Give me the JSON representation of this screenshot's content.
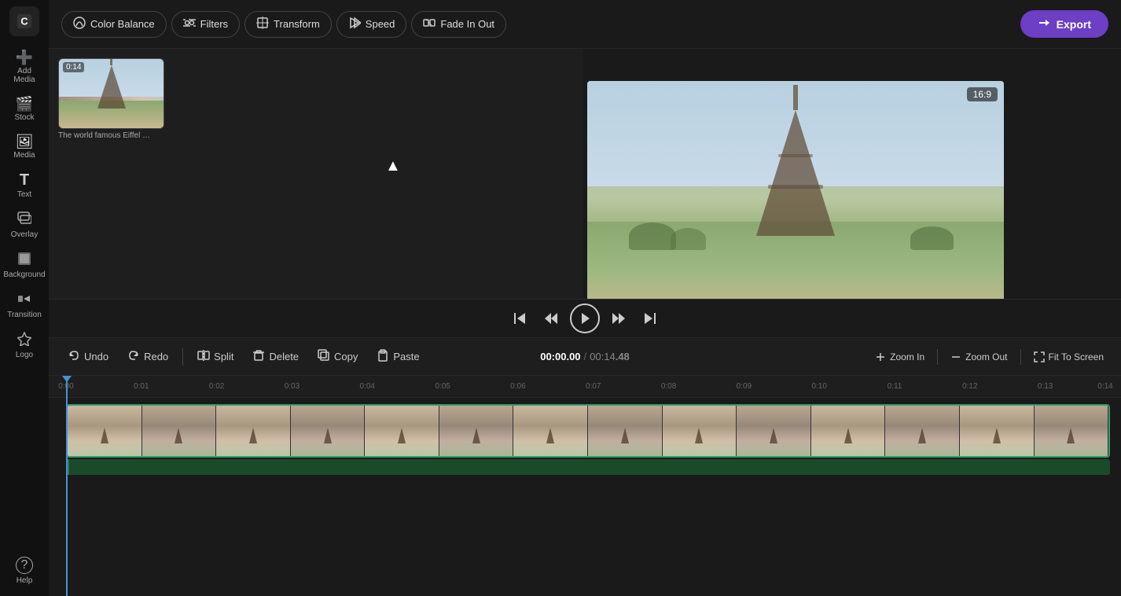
{
  "app": {
    "logo_letter": "C",
    "aspect_ratio": "16:9"
  },
  "sidebar": {
    "items": [
      {
        "id": "add-media",
        "icon": "➕",
        "label": "Add Media"
      },
      {
        "id": "stock",
        "icon": "🎬",
        "label": "Stock"
      },
      {
        "id": "media",
        "icon": "🖼️",
        "label": "Media"
      },
      {
        "id": "text",
        "icon": "T",
        "label": "Text"
      },
      {
        "id": "overlay",
        "icon": "⬛",
        "label": "Overlay"
      },
      {
        "id": "background",
        "icon": "🟪",
        "label": "Background"
      },
      {
        "id": "transition",
        "icon": "↔",
        "label": "Transition"
      },
      {
        "id": "logo",
        "icon": "⭐",
        "label": "Logo"
      },
      {
        "id": "help",
        "icon": "?",
        "label": "Help"
      }
    ]
  },
  "toolbar": {
    "color_balance": "Color Balance",
    "filters": "Filters",
    "transform": "Transform",
    "speed": "Speed",
    "fade_in_out": "Fade In Out",
    "export": "Export"
  },
  "media": {
    "thumb": {
      "time": "0:14",
      "label": "The world famous Eiffel …"
    }
  },
  "playback": {
    "skip_start": "⏮",
    "rewind": "⏪",
    "play": "▶",
    "fast_forward": "⏩",
    "skip_end": "⏭"
  },
  "action_toolbar": {
    "undo": "Undo",
    "redo": "Redo",
    "split": "Split",
    "delete": "Delete",
    "copy": "Copy",
    "paste": "Paste",
    "time_current": "00:00",
    "time_ms_current": ".00",
    "time_separator": "/",
    "time_total": "00:14",
    "time_ms_total": ".48",
    "zoom_in": "Zoom In",
    "zoom_out": "Zoom Out",
    "fit_to_screen": "Fit To Screen"
  },
  "timeline": {
    "ruler_marks": [
      {
        "label": "0:00",
        "position_pct": 0
      },
      {
        "label": "0:01",
        "position_pct": 7.14
      },
      {
        "label": "0:02",
        "position_pct": 14.28
      },
      {
        "label": "0:03",
        "position_pct": 21.42
      },
      {
        "label": "0:04",
        "position_pct": 28.56
      },
      {
        "label": "0:05",
        "position_pct": 35.7
      },
      {
        "label": "0:06",
        "position_pct": 42.84
      },
      {
        "label": "0:07",
        "position_pct": 49.98
      },
      {
        "label": "0:08",
        "position_pct": 57.12
      },
      {
        "label": "0:09",
        "position_pct": 64.26
      },
      {
        "label": "0:10",
        "position_pct": 71.4
      },
      {
        "label": "0:11",
        "position_pct": 78.54
      },
      {
        "label": "0:12",
        "position_pct": 85.68
      },
      {
        "label": "0:13",
        "position_pct": 92.82
      },
      {
        "label": "0:14",
        "position_pct": 100
      }
    ],
    "frame_count": 14
  }
}
